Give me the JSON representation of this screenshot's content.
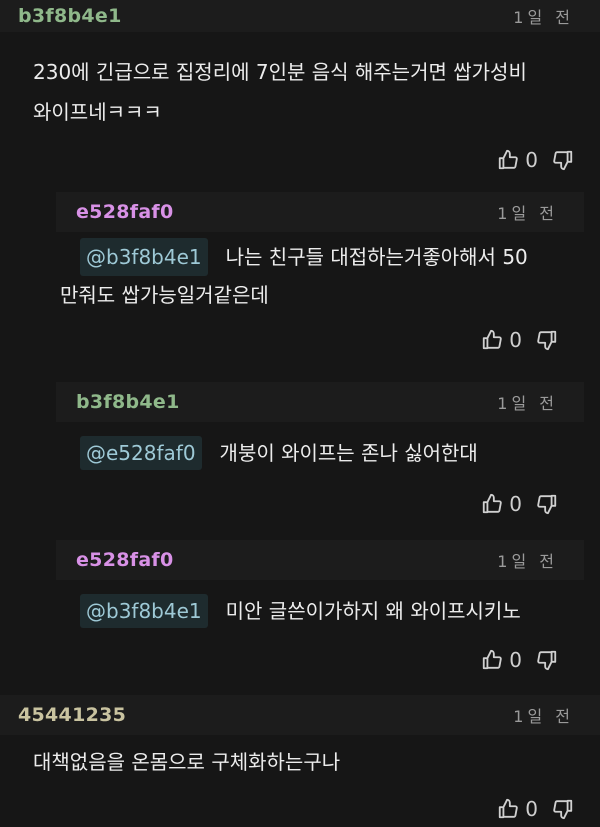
{
  "comments": [
    {
      "author": "b3f8b4e1",
      "time": "1일 전",
      "lines": [
        "230에 긴급으로 집정리에 7인분 음식 해주는거면 쌉가성비",
        "와이프네ㅋㅋㅋ"
      ],
      "likes": "0"
    },
    {
      "author": "e528faf0",
      "time": "1일 전",
      "mention": "@b3f8b4e1",
      "text": "나는 친구들 대접하는거좋아해서 50",
      "text2": "만줘도 쌉가능일거같은데",
      "likes": "0"
    },
    {
      "author": "b3f8b4e1",
      "time": "1일 전",
      "mention": "@e528faf0",
      "text": "개붕이 와이프는 존나 싫어한대",
      "likes": "0"
    },
    {
      "author": "e528faf0",
      "time": "1일 전",
      "mention": "@b3f8b4e1",
      "text": "미안 글쓴이가하지 왜 와이프시키노",
      "likes": "0"
    },
    {
      "author": "45441235",
      "time": "1일 전",
      "lines": [
        "대책없음을 온몸으로 구체화하는구나"
      ],
      "likes": "0"
    }
  ],
  "icons": {
    "like": "thumbs-up-icon",
    "dislike": "thumbs-down-icon"
  },
  "colors": {
    "background": "#161616",
    "green_author": "#8fb88a",
    "pink_author": "#d891e6",
    "tan_author": "#c9c3a0",
    "mention": "#9ec9d6"
  }
}
